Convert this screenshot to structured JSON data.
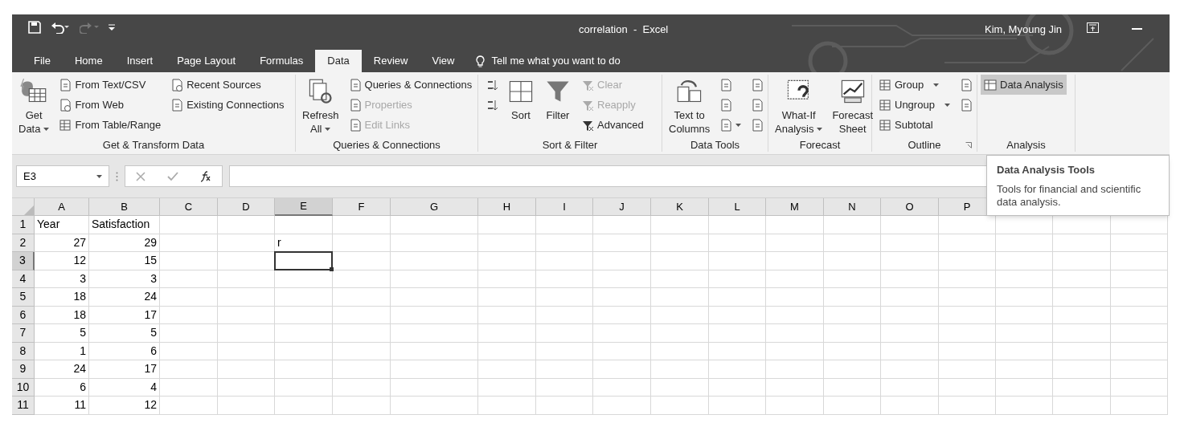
{
  "title_bar": {
    "title": "correlation  -  Excel",
    "user": "Kim, Myoung Jin"
  },
  "tabs": [
    {
      "label": "File",
      "selected": false
    },
    {
      "label": "Home",
      "selected": false
    },
    {
      "label": "Insert",
      "selected": false
    },
    {
      "label": "Page Layout",
      "selected": false
    },
    {
      "label": "Formulas",
      "selected": false
    },
    {
      "label": "Data",
      "selected": true
    },
    {
      "label": "Review",
      "selected": false
    },
    {
      "label": "View",
      "selected": false
    }
  ],
  "tell_me": "Tell me what you want to do",
  "ribbon": [
    {
      "label": "Get & Transform Data",
      "columns": [
        [
          {
            "kind": "large",
            "lines": [
              "Get",
              "Data"
            ],
            "dropdown": true,
            "disabled": false
          }
        ],
        [
          {
            "kind": "small",
            "label": "From Text/CSV",
            "dropdown": false,
            "disabled": false
          },
          {
            "kind": "small",
            "label": "From Web",
            "dropdown": false,
            "disabled": false
          },
          {
            "kind": "small",
            "label": "From Table/Range",
            "dropdown": false,
            "disabled": false
          }
        ],
        [
          {
            "kind": "small",
            "label": "Recent Sources",
            "dropdown": false,
            "disabled": false
          },
          {
            "kind": "small",
            "label": "Existing Connections",
            "dropdown": false,
            "disabled": false
          }
        ]
      ]
    },
    {
      "label": "Queries & Connections",
      "columns": [
        [
          {
            "kind": "large",
            "lines": [
              "Refresh",
              "All"
            ],
            "dropdown": true,
            "disabled": false
          }
        ],
        [
          {
            "kind": "small",
            "label": "Queries & Connections",
            "dropdown": false,
            "disabled": false
          },
          {
            "kind": "small",
            "label": "Properties",
            "dropdown": false,
            "disabled": true
          },
          {
            "kind": "small",
            "label": "Edit Links",
            "dropdown": false,
            "disabled": true
          }
        ]
      ]
    },
    {
      "label": "Sort & Filter",
      "columns": [
        [
          {
            "kind": "icon",
            "dropdown": false,
            "disabled": false
          },
          {
            "kind": "icon",
            "dropdown": false,
            "disabled": false
          }
        ],
        [
          {
            "kind": "large",
            "lines": [
              "Sort"
            ],
            "dropdown": false,
            "disabled": false
          }
        ],
        [
          {
            "kind": "large",
            "lines": [
              "Filter"
            ],
            "dropdown": false,
            "disabled": false
          }
        ],
        [
          {
            "kind": "small",
            "label": "Clear",
            "dropdown": false,
            "disabled": true
          },
          {
            "kind": "small",
            "label": "Reapply",
            "dropdown": false,
            "disabled": true
          },
          {
            "kind": "small",
            "label": "Advanced",
            "dropdown": false,
            "disabled": false
          }
        ]
      ]
    },
    {
      "label": "Data Tools",
      "columns": [
        [
          {
            "kind": "large",
            "lines": [
              "Text to",
              "Columns"
            ],
            "dropdown": false,
            "disabled": false
          }
        ],
        [
          {
            "kind": "icon",
            "dropdown": false,
            "disabled": false
          },
          {
            "kind": "icon",
            "dropdown": false,
            "disabled": false
          },
          {
            "kind": "icon",
            "dropdown": true,
            "disabled": false
          }
        ],
        [
          {
            "kind": "icon",
            "dropdown": false,
            "disabled": false
          },
          {
            "kind": "icon",
            "dropdown": false,
            "disabled": false
          },
          {
            "kind": "icon",
            "dropdown": false,
            "disabled": false
          }
        ]
      ]
    },
    {
      "label": "Forecast",
      "columns": [
        [
          {
            "kind": "large",
            "lines": [
              "What-If",
              "Analysis"
            ],
            "dropdown": true,
            "disabled": false
          }
        ],
        [
          {
            "kind": "large",
            "lines": [
              "Forecast",
              "Sheet"
            ],
            "dropdown": false,
            "disabled": false
          }
        ]
      ]
    },
    {
      "label": "Outline",
      "launcher_shown": true,
      "columns": [
        [
          {
            "kind": "small",
            "label": "Group",
            "dropdown": true,
            "disabled": false
          },
          {
            "kind": "small",
            "label": "Ungroup",
            "dropdown": true,
            "disabled": false
          },
          {
            "kind": "small",
            "label": "Subtotal",
            "dropdown": false,
            "disabled": false
          }
        ],
        [
          {
            "kind": "icon",
            "dropdown": false,
            "disabled": false
          },
          {
            "kind": "icon",
            "dropdown": false,
            "disabled": false
          }
        ]
      ]
    },
    {
      "label": "Analysis",
      "columns": [
        [
          {
            "kind": "small",
            "label": "Data Analysis",
            "dropdown": false,
            "disabled": false,
            "selected": true
          }
        ]
      ]
    }
  ],
  "formula_bar": {
    "name_box": "E3"
  },
  "sheet": {
    "columns": [
      {
        "label": "A",
        "selected": false
      },
      {
        "label": "B",
        "selected": false
      },
      {
        "label": "C",
        "selected": false
      },
      {
        "label": "D",
        "selected": false
      },
      {
        "label": "E",
        "selected": true
      },
      {
        "label": "F",
        "selected": false
      },
      {
        "label": "G",
        "selected": false
      },
      {
        "label": "H",
        "selected": false
      },
      {
        "label": "I",
        "selected": false
      },
      {
        "label": "J",
        "selected": false
      },
      {
        "label": "K",
        "selected": false
      },
      {
        "label": "L",
        "selected": false
      },
      {
        "label": "M",
        "selected": false
      },
      {
        "label": "N",
        "selected": false
      },
      {
        "label": "O",
        "selected": false
      },
      {
        "label": "P",
        "selected": false
      }
    ],
    "rows": [
      {
        "number": "1",
        "selected": false,
        "cells": [
          {
            "value": "Year",
            "right_aligned": false
          },
          {
            "value": "Satisfaction",
            "right_aligned": false
          }
        ]
      },
      {
        "number": "2",
        "selected": false,
        "cells": [
          {
            "value": "27",
            "right_aligned": true
          },
          {
            "value": "29",
            "right_aligned": true
          },
          null,
          null,
          {
            "value": "r",
            "right_aligned": false
          }
        ]
      },
      {
        "number": "3",
        "selected": true,
        "cells": [
          {
            "value": "12",
            "right_aligned": true
          },
          {
            "value": "15",
            "right_aligned": true
          },
          null,
          null,
          {
            "active": true
          }
        ]
      },
      {
        "number": "4",
        "selected": false,
        "cells": [
          {
            "value": "3",
            "right_aligned": true
          },
          {
            "value": "3",
            "right_aligned": true
          }
        ]
      },
      {
        "number": "5",
        "selected": false,
        "cells": [
          {
            "value": "18",
            "right_aligned": true
          },
          {
            "value": "24",
            "right_aligned": true
          }
        ]
      },
      {
        "number": "6",
        "selected": false,
        "cells": [
          {
            "value": "18",
            "right_aligned": true
          },
          {
            "value": "17",
            "right_aligned": true
          }
        ]
      },
      {
        "number": "7",
        "selected": false,
        "cells": [
          {
            "value": "5",
            "right_aligned": true
          },
          {
            "value": "5",
            "right_aligned": true
          }
        ]
      },
      {
        "number": "8",
        "selected": false,
        "cells": [
          {
            "value": "1",
            "right_aligned": true
          },
          {
            "value": "6",
            "right_aligned": true
          }
        ]
      },
      {
        "number": "9",
        "selected": false,
        "cells": [
          {
            "value": "24",
            "right_aligned": true
          },
          {
            "value": "17",
            "right_aligned": true
          }
        ]
      },
      {
        "number": "10",
        "selected": false,
        "cells": [
          {
            "value": "6",
            "right_aligned": true
          },
          {
            "value": "4",
            "right_aligned": true
          }
        ]
      },
      {
        "number": "11",
        "selected": false,
        "cells": [
          {
            "value": "11",
            "right_aligned": true
          },
          {
            "value": "12",
            "right_aligned": true
          }
        ]
      }
    ]
  },
  "tooltip": {
    "title": "Data Analysis Tools",
    "text": "Tools for financial and scientific data analysis."
  }
}
